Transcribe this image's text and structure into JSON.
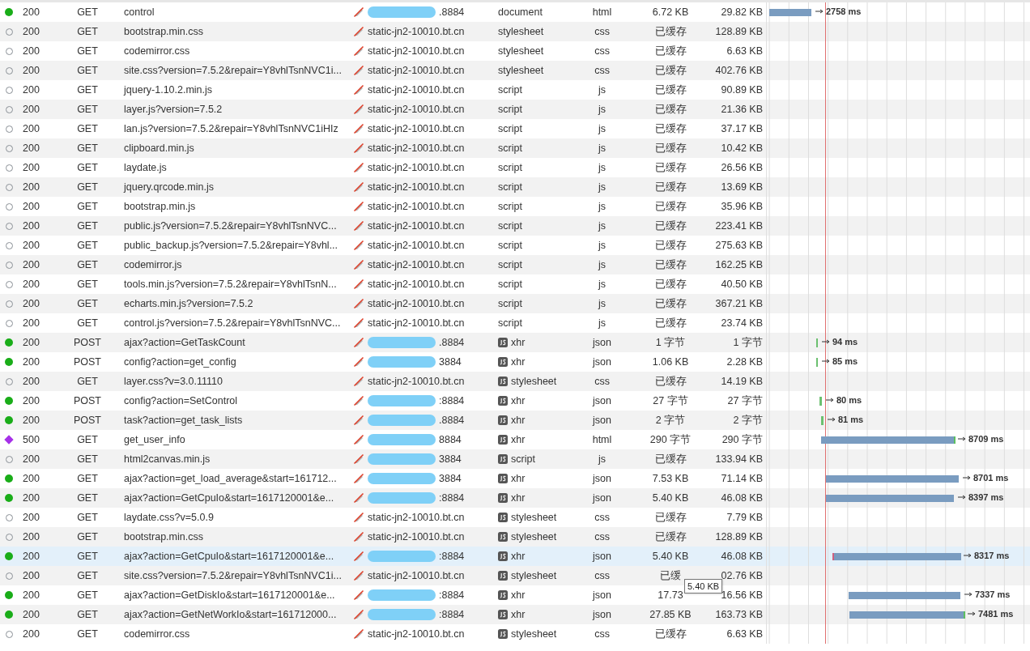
{
  "requests": [
    {
      "kind": "dot",
      "status": "200",
      "method": "GET",
      "name": "control",
      "host": ".8884",
      "redacted": true,
      "type": "document",
      "type_icon": false,
      "mime": "html",
      "size": "6.72 KB",
      "transfer": "29.82 KB",
      "duration": "2758 ms",
      "selected": false
    },
    {
      "kind": "circle",
      "status": "200",
      "method": "GET",
      "name": "bootstrap.min.css",
      "host": "static-jn2-10010.bt.cn",
      "redacted": false,
      "type": "stylesheet",
      "type_icon": false,
      "mime": "css",
      "size": "已缓存",
      "transfer": "128.89 KB",
      "selected": false
    },
    {
      "kind": "circle",
      "status": "200",
      "method": "GET",
      "name": "codemirror.css",
      "host": "static-jn2-10010.bt.cn",
      "redacted": false,
      "type": "stylesheet",
      "type_icon": false,
      "mime": "css",
      "size": "已缓存",
      "transfer": "6.63 KB",
      "selected": false
    },
    {
      "kind": "circle",
      "status": "200",
      "method": "GET",
      "name": "site.css?version=7.5.2&repair=Y8vhlTsnNVC1i...",
      "host": "static-jn2-10010.bt.cn",
      "redacted": false,
      "type": "stylesheet",
      "type_icon": false,
      "mime": "css",
      "size": "已缓存",
      "transfer": "402.76 KB",
      "selected": false
    },
    {
      "kind": "circle",
      "status": "200",
      "method": "GET",
      "name": "jquery-1.10.2.min.js",
      "host": "static-jn2-10010.bt.cn",
      "redacted": false,
      "type": "script",
      "type_icon": false,
      "mime": "js",
      "size": "已缓存",
      "transfer": "90.89 KB",
      "selected": false
    },
    {
      "kind": "circle",
      "status": "200",
      "method": "GET",
      "name": "layer.js?version=7.5.2",
      "host": "static-jn2-10010.bt.cn",
      "redacted": false,
      "type": "script",
      "type_icon": false,
      "mime": "js",
      "size": "已缓存",
      "transfer": "21.36 KB",
      "selected": false
    },
    {
      "kind": "circle",
      "status": "200",
      "method": "GET",
      "name": "lan.js?version=7.5.2&repair=Y8vhlTsnNVC1iHIz",
      "host": "static-jn2-10010.bt.cn",
      "redacted": false,
      "type": "script",
      "type_icon": false,
      "mime": "js",
      "size": "已缓存",
      "transfer": "37.17 KB",
      "selected": false
    },
    {
      "kind": "circle",
      "status": "200",
      "method": "GET",
      "name": "clipboard.min.js",
      "host": "static-jn2-10010.bt.cn",
      "redacted": false,
      "type": "script",
      "type_icon": false,
      "mime": "js",
      "size": "已缓存",
      "transfer": "10.42 KB",
      "selected": false
    },
    {
      "kind": "circle",
      "status": "200",
      "method": "GET",
      "name": "laydate.js",
      "host": "static-jn2-10010.bt.cn",
      "redacted": false,
      "type": "script",
      "type_icon": false,
      "mime": "js",
      "size": "已缓存",
      "transfer": "26.56 KB",
      "selected": false
    },
    {
      "kind": "circle",
      "status": "200",
      "method": "GET",
      "name": "jquery.qrcode.min.js",
      "host": "static-jn2-10010.bt.cn",
      "redacted": false,
      "type": "script",
      "type_icon": false,
      "mime": "js",
      "size": "已缓存",
      "transfer": "13.69 KB",
      "selected": false
    },
    {
      "kind": "circle",
      "status": "200",
      "method": "GET",
      "name": "bootstrap.min.js",
      "host": "static-jn2-10010.bt.cn",
      "redacted": false,
      "type": "script",
      "type_icon": false,
      "mime": "js",
      "size": "已缓存",
      "transfer": "35.96 KB",
      "selected": false
    },
    {
      "kind": "circle",
      "status": "200",
      "method": "GET",
      "name": "public.js?version=7.5.2&repair=Y8vhlTsnNVC...",
      "host": "static-jn2-10010.bt.cn",
      "redacted": false,
      "type": "script",
      "type_icon": false,
      "mime": "js",
      "size": "已缓存",
      "transfer": "223.41 KB",
      "selected": false
    },
    {
      "kind": "circle",
      "status": "200",
      "method": "GET",
      "name": "public_backup.js?version=7.5.2&repair=Y8vhl...",
      "host": "static-jn2-10010.bt.cn",
      "redacted": false,
      "type": "script",
      "type_icon": false,
      "mime": "js",
      "size": "已缓存",
      "transfer": "275.63 KB",
      "selected": false
    },
    {
      "kind": "circle",
      "status": "200",
      "method": "GET",
      "name": "codemirror.js",
      "host": "static-jn2-10010.bt.cn",
      "redacted": false,
      "type": "script",
      "type_icon": false,
      "mime": "js",
      "size": "已缓存",
      "transfer": "162.25 KB",
      "selected": false
    },
    {
      "kind": "circle",
      "status": "200",
      "method": "GET",
      "name": "tools.min.js?version=7.5.2&repair=Y8vhlTsnN...",
      "host": "static-jn2-10010.bt.cn",
      "redacted": false,
      "type": "script",
      "type_icon": false,
      "mime": "js",
      "size": "已缓存",
      "transfer": "40.50 KB",
      "selected": false
    },
    {
      "kind": "circle",
      "status": "200",
      "method": "GET",
      "name": "echarts.min.js?version=7.5.2",
      "host": "static-jn2-10010.bt.cn",
      "redacted": false,
      "type": "script",
      "type_icon": false,
      "mime": "js",
      "size": "已缓存",
      "transfer": "367.21 KB",
      "selected": false
    },
    {
      "kind": "circle",
      "status": "200",
      "method": "GET",
      "name": "control.js?version=7.5.2&repair=Y8vhlTsnNVC...",
      "host": "static-jn2-10010.bt.cn",
      "redacted": false,
      "type": "script",
      "type_icon": false,
      "mime": "js",
      "size": "已缓存",
      "transfer": "23.74 KB",
      "selected": false
    },
    {
      "kind": "dot",
      "status": "200",
      "method": "POST",
      "name": "ajax?action=GetTaskCount",
      "host": ".8884",
      "redacted": true,
      "type": "xhr",
      "type_icon": true,
      "mime": "json",
      "size": "1 字节",
      "transfer": "1 字节",
      "duration": "94 ms",
      "selected": false
    },
    {
      "kind": "dot",
      "status": "200",
      "method": "POST",
      "name": "config?action=get_config",
      "host": "3884",
      "redacted": true,
      "type": "xhr",
      "type_icon": true,
      "mime": "json",
      "size": "1.06 KB",
      "transfer": "2.28 KB",
      "duration": "85 ms",
      "selected": false
    },
    {
      "kind": "circle",
      "status": "200",
      "method": "GET",
      "name": "layer.css?v=3.0.11110",
      "host": "static-jn2-10010.bt.cn",
      "redacted": false,
      "type": "stylesheet",
      "type_icon": true,
      "mime": "css",
      "size": "已缓存",
      "transfer": "14.19 KB",
      "selected": false
    },
    {
      "kind": "dot",
      "status": "200",
      "method": "POST",
      "name": "config?action=SetControl",
      "host": ":8884",
      "redacted": true,
      "type": "xhr",
      "type_icon": true,
      "mime": "json",
      "size": "27 字节",
      "transfer": "27 字节",
      "duration": "80 ms",
      "selected": false
    },
    {
      "kind": "dot",
      "status": "200",
      "method": "POST",
      "name": "task?action=get_task_lists",
      "host": ".8884",
      "redacted": true,
      "type": "xhr",
      "type_icon": true,
      "mime": "json",
      "size": "2 字节",
      "transfer": "2 字节",
      "duration": "81 ms",
      "selected": false
    },
    {
      "kind": "diamond",
      "status": "500",
      "method": "GET",
      "name": "get_user_info",
      "host": "8884",
      "redacted": true,
      "type": "xhr",
      "type_icon": true,
      "mime": "html",
      "size": "290 字节",
      "transfer": "290 字节",
      "duration": "8709 ms",
      "selected": false
    },
    {
      "kind": "circle",
      "status": "200",
      "method": "GET",
      "name": "html2canvas.min.js",
      "host": "3884",
      "redacted": true,
      "type": "script",
      "type_icon": true,
      "mime": "js",
      "size": "已缓存",
      "transfer": "133.94 KB",
      "selected": false
    },
    {
      "kind": "dot",
      "status": "200",
      "method": "GET",
      "name": "ajax?action=get_load_average&start=161712...",
      "host": "3884",
      "redacted": true,
      "type": "xhr",
      "type_icon": true,
      "mime": "json",
      "size": "7.53 KB",
      "transfer": "71.14 KB",
      "duration": "8701 ms",
      "selected": false
    },
    {
      "kind": "dot",
      "status": "200",
      "method": "GET",
      "name": "ajax?action=GetCpuIo&start=1617120001&e...",
      "host": ":8884",
      "redacted": true,
      "type": "xhr",
      "type_icon": true,
      "mime": "json",
      "size": "5.40 KB",
      "transfer": "46.08 KB",
      "duration": "8397 ms",
      "selected": false
    },
    {
      "kind": "circle",
      "status": "200",
      "method": "GET",
      "name": "laydate.css?v=5.0.9",
      "host": "static-jn2-10010.bt.cn",
      "redacted": false,
      "type": "stylesheet",
      "type_icon": true,
      "mime": "css",
      "size": "已缓存",
      "transfer": "7.79 KB",
      "selected": false
    },
    {
      "kind": "circle",
      "status": "200",
      "method": "GET",
      "name": "bootstrap.min.css",
      "host": "static-jn2-10010.bt.cn",
      "redacted": false,
      "type": "stylesheet",
      "type_icon": true,
      "mime": "css",
      "size": "已缓存",
      "transfer": "128.89 KB",
      "selected": false
    },
    {
      "kind": "dot",
      "status": "200",
      "method": "GET",
      "name": "ajax?action=GetCpuIo&start=1617120001&e...",
      "host": ":8884",
      "redacted": true,
      "type": "xhr",
      "type_icon": true,
      "mime": "json",
      "size": "5.40 KB",
      "transfer": "46.08 KB",
      "duration": "8317 ms",
      "selected": true
    },
    {
      "kind": "circle",
      "status": "200",
      "method": "GET",
      "name": "site.css?version=7.5.2&repair=Y8vhlTsnNVC1i...",
      "host": "static-jn2-10010.bt.cn",
      "redacted": false,
      "type": "stylesheet",
      "type_icon": true,
      "mime": "css",
      "size": "已缓",
      "transfer": "02.76 KB",
      "selected": false
    },
    {
      "kind": "dot",
      "status": "200",
      "method": "GET",
      "name": "ajax?action=GetDiskIo&start=1617120001&e...",
      "host": ":8884",
      "redacted": true,
      "type": "xhr",
      "type_icon": true,
      "mime": "json",
      "size": "17.73",
      "transfer": "16.56 KB",
      "duration": "7337 ms",
      "selected": false
    },
    {
      "kind": "dot",
      "status": "200",
      "method": "GET",
      "name": "ajax?action=GetNetWorkIo&start=161712000...",
      "host": ":8884",
      "redacted": true,
      "type": "xhr",
      "type_icon": true,
      "mime": "json",
      "size": "27.85 KB",
      "transfer": "163.73 KB",
      "duration": "7481 ms",
      "selected": false
    },
    {
      "kind": "circle",
      "status": "200",
      "method": "GET",
      "name": "codemirror.css",
      "host": "static-jn2-10010.bt.cn",
      "redacted": false,
      "type": "stylesheet",
      "type_icon": true,
      "mime": "css",
      "size": "已缓存",
      "transfer": "6.63 KB",
      "selected": false
    }
  ],
  "tooltip": {
    "text": "5.40 KB"
  }
}
